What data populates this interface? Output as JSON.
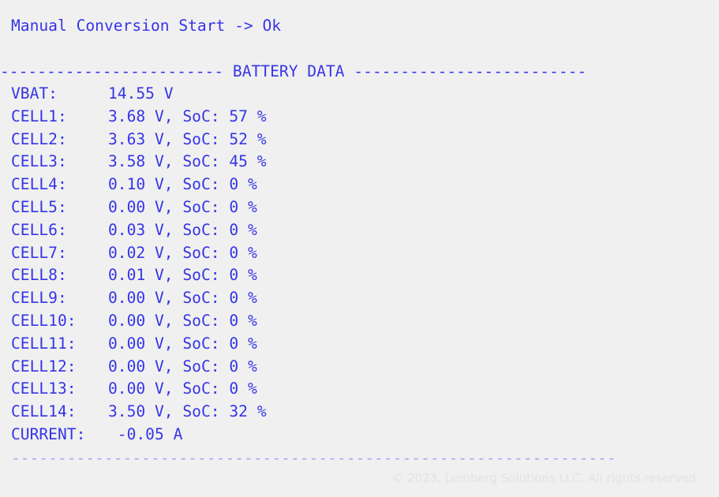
{
  "terminal": {
    "status_line": "Manual Conversion Start -> Ok",
    "section_header": {
      "left_rule": "------------------------ ",
      "title": "BATTERY DATA",
      "right_rule": " -------------------------"
    },
    "vbat": {
      "label": "VBAT:",
      "value": "14.55 V"
    },
    "cells": [
      {
        "label": "CELL1:",
        "value": "3.68 V, SoC: 57 %"
      },
      {
        "label": "CELL2:",
        "value": "3.63 V, SoC: 52 %"
      },
      {
        "label": "CELL3:",
        "value": "3.58 V, SoC: 45 %"
      },
      {
        "label": "CELL4:",
        "value": "0.10 V, SoC: 0 %"
      },
      {
        "label": "CELL5:",
        "value": "0.00 V, SoC: 0 %"
      },
      {
        "label": "CELL6:",
        "value": "0.03 V, SoC: 0 %"
      },
      {
        "label": "CELL7:",
        "value": "0.02 V, SoC: 0 %"
      },
      {
        "label": "CELL8:",
        "value": "0.01 V, SoC: 0 %"
      },
      {
        "label": "CELL9:",
        "value": "0.00 V, SoC: 0 %"
      },
      {
        "label": "CELL10:",
        "value": "0.00 V, SoC: 0 %"
      },
      {
        "label": "CELL11:",
        "value": "0.00 V, SoC: 0 %"
      },
      {
        "label": "CELL12:",
        "value": "0.00 V, SoC: 0 %"
      },
      {
        "label": "CELL13:",
        "value": "0.00 V, SoC: 0 %"
      },
      {
        "label": "CELL14:",
        "value": "3.50 V, SoC: 32 %"
      }
    ],
    "current": {
      "label": "CURRENT:",
      "value": " -0.05 A"
    },
    "footer_rule": "-----------------------------------------------------------------"
  },
  "copyright": "© 2023, Lemberg Solutions LLC. All rights reserved.",
  "colors": {
    "text": "#3535e6",
    "background": "#f0f0f0",
    "footer_rule": "#a8a4f0",
    "watermark": "#e2e2e8"
  }
}
